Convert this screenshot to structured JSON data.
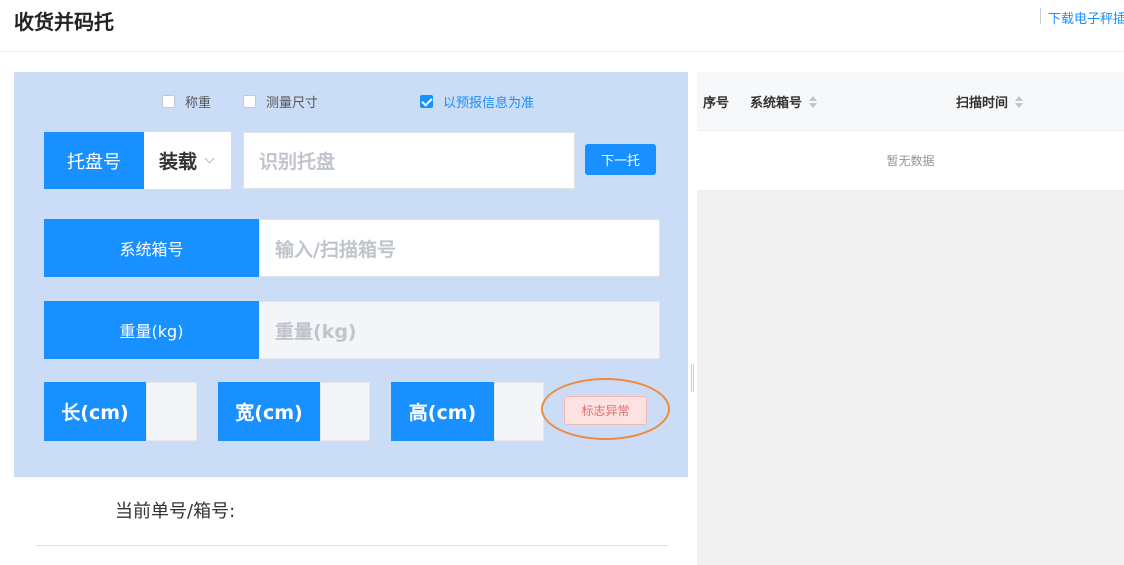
{
  "header": {
    "title": "收货并码托",
    "link": "下载电子秤插"
  },
  "options": {
    "weigh": {
      "label": "称重",
      "checked": false
    },
    "measure": {
      "label": "测量尺寸",
      "checked": false
    },
    "use_forecast": {
      "label": "以预报信息为准",
      "checked": true
    }
  },
  "pallet": {
    "label": "托盘号",
    "mode_value": "装载",
    "input_placeholder": "识别托盘",
    "next_label": "下一托"
  },
  "box_no": {
    "label": "系统箱号",
    "placeholder": "输入/扫描箱号"
  },
  "weight": {
    "label": "重量(kg)",
    "placeholder": "重量(kg)"
  },
  "dims": {
    "length_label": "长(cm)",
    "width_label": "宽(cm)",
    "height_label": "高(cm)"
  },
  "flag_button": "标志异常",
  "current": {
    "label": "当前单号/箱号:"
  },
  "table": {
    "columns": [
      {
        "label": "序号",
        "sortable": false
      },
      {
        "label": "系统箱号",
        "sortable": true
      },
      {
        "label": "扫描时间",
        "sortable": true
      }
    ],
    "empty_text": "暂无数据"
  },
  "colors": {
    "primary": "#1890ff",
    "panel_bg": "#cbdcf7",
    "flag_bg": "#fde2e2",
    "flag_text": "#e06c6c",
    "highlight_ring": "#ee8a3c"
  }
}
